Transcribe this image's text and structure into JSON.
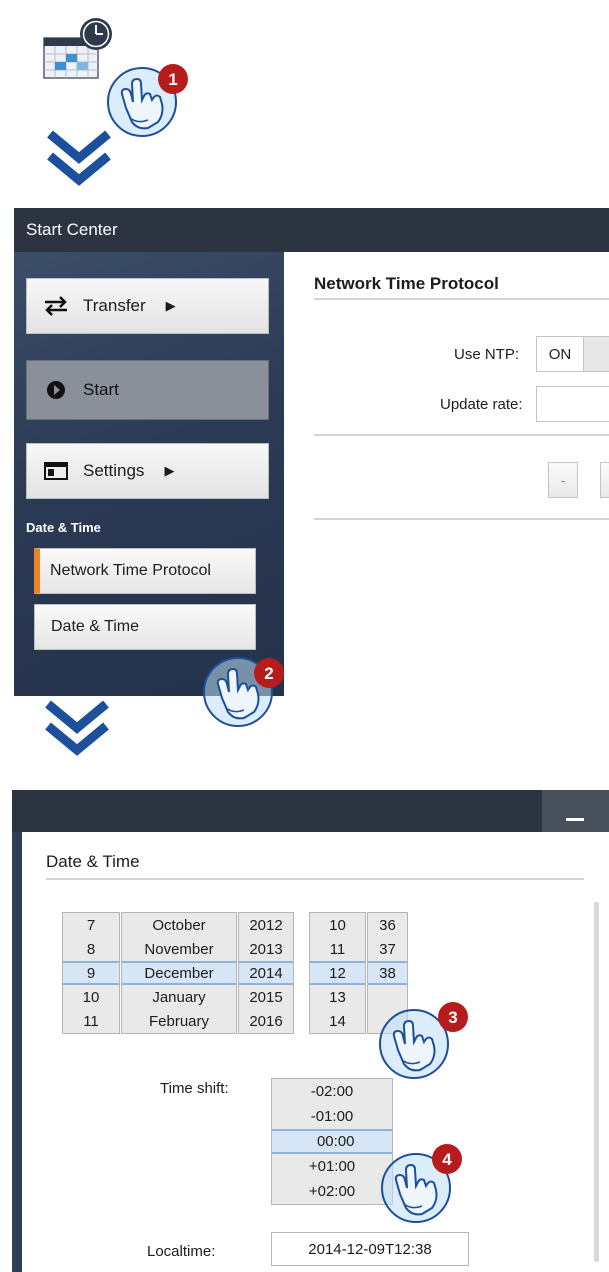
{
  "colors": {
    "titlebar": "#2b3440",
    "accent": "#ef8220",
    "arrow": "#1c4f9c",
    "callout": "#b71c1c",
    "selection": "#d6e6f6"
  },
  "callouts": [
    "1",
    "2",
    "3",
    "4"
  ],
  "start_center": {
    "title": "Start Center",
    "sidebar": {
      "transfer": "Transfer",
      "start": "Start",
      "settings": "Settings",
      "section": "Date & Time",
      "ntp": "Network Time Protocol",
      "date_time": "Date & Time"
    },
    "content": {
      "heading": "Network Time Protocol",
      "use_ntp_label": "Use NTP:",
      "use_ntp_on": "ON",
      "update_rate_label": "Update rate:",
      "minus": "-"
    }
  },
  "date_time": {
    "heading": "Date & Time",
    "days": [
      "7",
      "8",
      "9",
      "10",
      "11"
    ],
    "months": [
      "October",
      "November",
      "December",
      "January",
      "February"
    ],
    "years": [
      "2012",
      "2013",
      "2014",
      "2015",
      "2016"
    ],
    "hours": [
      "10",
      "11",
      "12",
      "13",
      "14"
    ],
    "minutes": [
      "36",
      "37",
      "38",
      "",
      ""
    ],
    "time_shift_label": "Time shift:",
    "time_shifts": [
      "-02:00",
      "-01:00",
      " 00:00",
      "+01:00",
      "+02:00"
    ],
    "localtime_label": "Localtime:",
    "localtime_value": "2014-12-09T12:38"
  }
}
